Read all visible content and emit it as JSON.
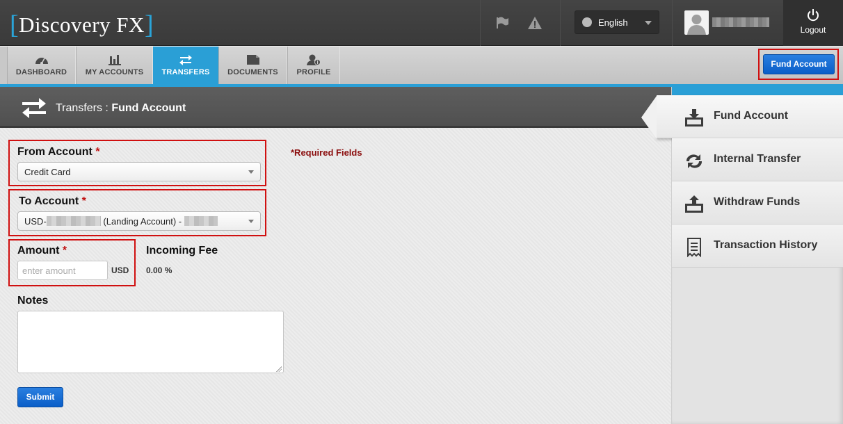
{
  "header": {
    "logo_bracket_open": "[",
    "logo_text": "Discovery FX",
    "logo_bracket_close": "]",
    "language": "English",
    "logout_label": "Logout",
    "icons": {
      "flag": "flag-icon",
      "alert": "alert-icon",
      "globe": "globe-icon",
      "logout": "power-icon",
      "avatar": "user-avatar-icon"
    }
  },
  "nav": {
    "items": [
      {
        "label": "DASHBOARD",
        "icon": "gauge-icon"
      },
      {
        "label": "MY ACCOUNTS",
        "icon": "bar-chart-icon"
      },
      {
        "label": "TRANSFERS",
        "icon": "transfer-arrows-icon",
        "active": true
      },
      {
        "label": "DOCUMENTS",
        "icon": "folder-icon"
      },
      {
        "label": "PROFILE",
        "icon": "profile-icon"
      }
    ],
    "fund_account_button": "Fund Account"
  },
  "page_title": {
    "section": "Transfers",
    "separator": " : ",
    "page": "Fund Account"
  },
  "form": {
    "from_account": {
      "label": "From Account",
      "required_mark": "*",
      "value": "Credit Card"
    },
    "to_account": {
      "label": "To Account",
      "required_mark": "*",
      "value_prefix": "USD-",
      "value_middle": " (Landing Account) - "
    },
    "amount": {
      "label": "Amount",
      "required_mark": "*",
      "placeholder": "enter amount",
      "currency": "USD"
    },
    "incoming_fee": {
      "label": "Incoming Fee",
      "value": "0.00 %"
    },
    "notes": {
      "label": "Notes"
    },
    "required_note": "*Required Fields",
    "submit_label": "Submit"
  },
  "sidebar": {
    "items": [
      {
        "label": "Fund Account",
        "icon": "fund-deposit-icon",
        "active": true
      },
      {
        "label": "Internal Transfer",
        "icon": "internal-transfer-icon"
      },
      {
        "label": "Withdraw Funds",
        "icon": "withdraw-icon"
      },
      {
        "label": "Transaction History",
        "icon": "receipt-icon"
      }
    ]
  },
  "colors": {
    "accent": "#2a9fd6",
    "button": "#0a5ec8",
    "required": "#c01010",
    "highlight_box": "#d01010"
  }
}
